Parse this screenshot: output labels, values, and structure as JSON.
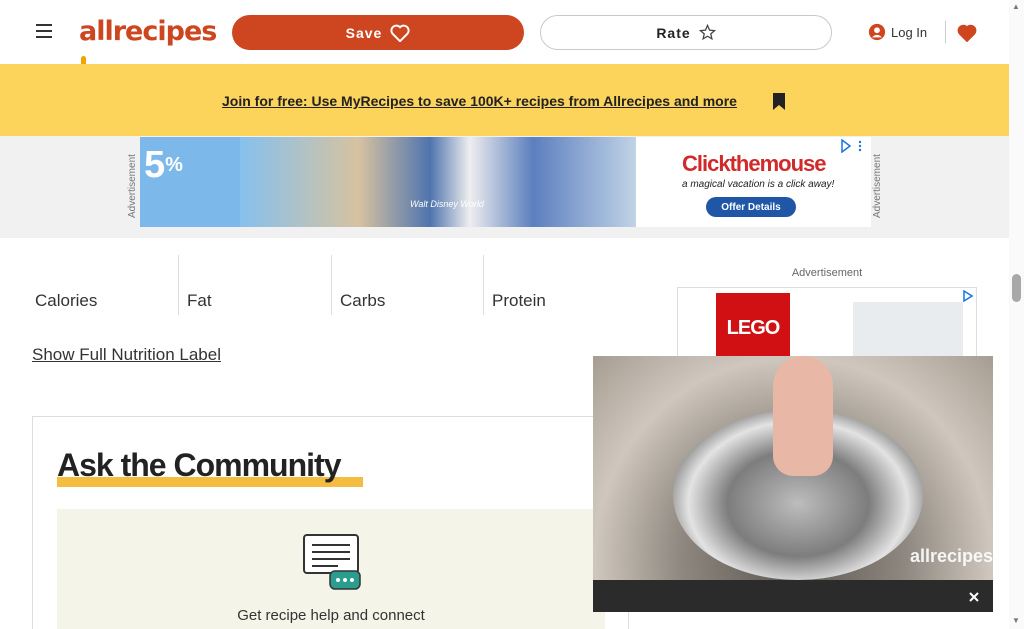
{
  "header": {
    "menu_icon": "hamburger-icon",
    "logo_text": "allrecipes",
    "save_label": "Save",
    "rate_label": "Rate",
    "login_label": "Log In",
    "brand_color": "#ce4620"
  },
  "promo": {
    "text": "Join for free: Use MyRecipes to save 100K+ recipes from Allrecipes and more",
    "background": "#fcd45b"
  },
  "top_ad": {
    "label": "Advertisement",
    "percent": "5",
    "percent_sign": "%",
    "disney_text": "Walt Disney World",
    "brand": "Clickthemouse",
    "tagline": "a magical vacation is a click away!",
    "cta": "Offer Details"
  },
  "nutrition": {
    "items": [
      {
        "value": "",
        "label": "Calories"
      },
      {
        "value": "",
        "label": "Fat"
      },
      {
        "value": "",
        "label": "Carbs"
      },
      {
        "value": "",
        "label": "Protein"
      }
    ],
    "show_full_label": "Show Full Nutrition Label"
  },
  "community": {
    "title": "Ask the Community",
    "text": "Get recipe help and connect"
  },
  "side_ad": {
    "label": "Advertisement",
    "brand": "LEGO"
  },
  "video": {
    "watermark": "allrecipes"
  }
}
